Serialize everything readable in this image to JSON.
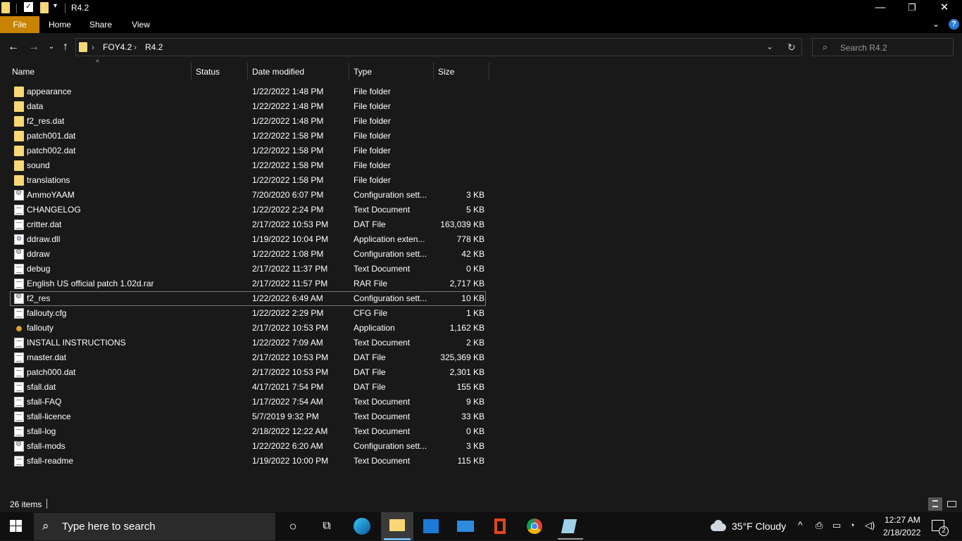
{
  "window": {
    "title": "R4.2",
    "controls": {
      "minimize": "—",
      "restore": "❐",
      "close": "✕"
    }
  },
  "ribbon": {
    "tabs": [
      {
        "label": "File"
      },
      {
        "label": "Home"
      },
      {
        "label": "Share"
      },
      {
        "label": "View"
      }
    ]
  },
  "address": {
    "breadcrumb": [
      "FOY4.2",
      "R4.2"
    ],
    "separator": "›"
  },
  "search": {
    "placeholder": "Search R4.2"
  },
  "columns": {
    "name": "Name",
    "status": "Status",
    "date": "Date modified",
    "type": "Type",
    "size": "Size"
  },
  "files": [
    {
      "name": "appearance",
      "date": "1/22/2022 1:48 PM",
      "type": "File folder",
      "size": "",
      "icon": "folder-icon"
    },
    {
      "name": "data",
      "date": "1/22/2022 1:48 PM",
      "type": "File folder",
      "size": "",
      "icon": "folder-icon"
    },
    {
      "name": "f2_res.dat",
      "date": "1/22/2022 1:48 PM",
      "type": "File folder",
      "size": "",
      "icon": "folder-icon"
    },
    {
      "name": "patch001.dat",
      "date": "1/22/2022 1:58 PM",
      "type": "File folder",
      "size": "",
      "icon": "folder-icon"
    },
    {
      "name": "patch002.dat",
      "date": "1/22/2022 1:58 PM",
      "type": "File folder",
      "size": "",
      "icon": "folder-icon"
    },
    {
      "name": "sound",
      "date": "1/22/2022 1:58 PM",
      "type": "File folder",
      "size": "",
      "icon": "folder-icon"
    },
    {
      "name": "translations",
      "date": "1/22/2022 1:58 PM",
      "type": "File folder",
      "size": "",
      "icon": "folder-icon"
    },
    {
      "name": "AmmoYAAM",
      "date": "7/20/2020 6:07 PM",
      "type": "Configuration sett...",
      "size": "3 KB",
      "icon": "config-file-icon"
    },
    {
      "name": "CHANGELOG",
      "date": "1/22/2022 2:24 PM",
      "type": "Text Document",
      "size": "5 KB",
      "icon": "text-file-icon"
    },
    {
      "name": "critter.dat",
      "date": "2/17/2022 10:53 PM",
      "type": "DAT File",
      "size": "163,039 KB",
      "icon": "file-icon"
    },
    {
      "name": "ddraw.dll",
      "date": "1/19/2022 10:04 PM",
      "type": "Application exten...",
      "size": "778 KB",
      "icon": "dll-file-icon"
    },
    {
      "name": "ddraw",
      "date": "1/22/2022 1:08 PM",
      "type": "Configuration sett...",
      "size": "42 KB",
      "icon": "config-file-icon"
    },
    {
      "name": "debug",
      "date": "2/17/2022 11:37 PM",
      "type": "Text Document",
      "size": "0 KB",
      "icon": "text-file-icon"
    },
    {
      "name": "English US official patch 1.02d.rar",
      "date": "2/17/2022 11:57 PM",
      "type": "RAR File",
      "size": "2,717 KB",
      "icon": "file-icon"
    },
    {
      "name": "f2_res",
      "date": "1/22/2022 6:49 AM",
      "type": "Configuration sett...",
      "size": "10 KB",
      "icon": "config-file-icon",
      "selected": true
    },
    {
      "name": "fallouty.cfg",
      "date": "1/22/2022 2:29 PM",
      "type": "CFG File",
      "size": "1 KB",
      "icon": "file-icon"
    },
    {
      "name": "fallouty",
      "date": "2/17/2022 10:53 PM",
      "type": "Application",
      "size": "1,162 KB",
      "icon": "app-icon"
    },
    {
      "name": "INSTALL INSTRUCTIONS",
      "date": "1/22/2022 7:09 AM",
      "type": "Text Document",
      "size": "2 KB",
      "icon": "text-file-icon"
    },
    {
      "name": "master.dat",
      "date": "2/17/2022 10:53 PM",
      "type": "DAT File",
      "size": "325,369 KB",
      "icon": "file-icon"
    },
    {
      "name": "patch000.dat",
      "date": "2/17/2022 10:53 PM",
      "type": "DAT File",
      "size": "2,301 KB",
      "icon": "file-icon"
    },
    {
      "name": "sfall.dat",
      "date": "4/17/2021 7:54 PM",
      "type": "DAT File",
      "size": "155 KB",
      "icon": "file-icon"
    },
    {
      "name": "sfall-FAQ",
      "date": "1/17/2022 7:54 AM",
      "type": "Text Document",
      "size": "9 KB",
      "icon": "text-file-icon"
    },
    {
      "name": "sfall-licence",
      "date": "5/7/2019 9:32 PM",
      "type": "Text Document",
      "size": "33 KB",
      "icon": "text-file-icon"
    },
    {
      "name": "sfall-log",
      "date": "2/18/2022 12:22 AM",
      "type": "Text Document",
      "size": "0 KB",
      "icon": "text-file-icon"
    },
    {
      "name": "sfall-mods",
      "date": "1/22/2022 6:20 AM",
      "type": "Configuration sett...",
      "size": "3 KB",
      "icon": "config-file-icon"
    },
    {
      "name": "sfall-readme",
      "date": "1/19/2022 10:00 PM",
      "type": "Text Document",
      "size": "115 KB",
      "icon": "text-file-icon"
    }
  ],
  "status": {
    "item_count": "26 items"
  },
  "taskbar": {
    "search_placeholder": "Type here to search",
    "weather": "35°F  Cloudy",
    "time": "12:27 AM",
    "date": "2/18/2022",
    "notification_count": "2"
  },
  "colors": {
    "accent": "#c88300",
    "folder": "#f8d775",
    "background": "#191919"
  }
}
